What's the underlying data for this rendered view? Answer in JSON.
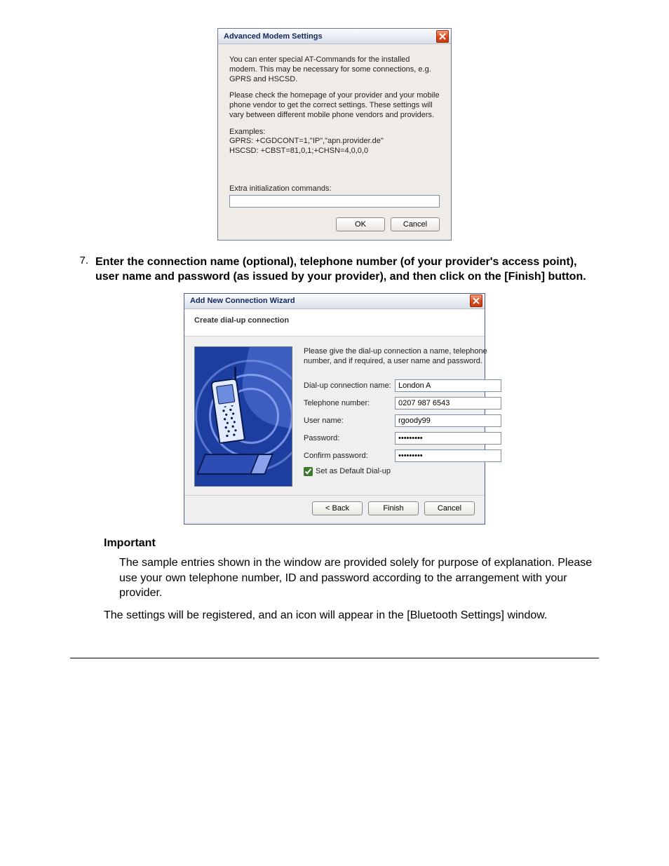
{
  "dlg1": {
    "title": "Advanced Modem Settings",
    "p1": "You can enter special AT-Commands for the installed modem. This may be necessary for some connections, e.g. GPRS and HSCSD.",
    "p2": "Please check the homepage of your provider and your mobile phone vendor to get the correct settings. These settings will vary between different mobile phone vendors and providers.",
    "examples_label": "Examples:",
    "example_gprs": "GPRS: +CGDCONT=1,\"IP\",\"apn.provider.de\"",
    "example_hscsd": "HSCSD: +CBST=81,0,1;+CHSN=4,0,0,0",
    "extra_label": "Extra initialization commands:",
    "extra_value": "",
    "ok": "OK",
    "cancel": "Cancel"
  },
  "step7": {
    "num": "7.",
    "text": "Enter the connection name (optional), telephone number (of your provider's access point), user name and password (as issued by your provider), and then click on the [Finish] button."
  },
  "dlg2": {
    "title": "Add New Connection Wizard",
    "subtitle": "Create dial-up connection",
    "intro": "Please give the dial-up connection a name, telephone number, and if required, a user name and password.",
    "conn_name_label": "Dial-up connection name:",
    "conn_name_value": "London A",
    "phone_label": "Telephone number:",
    "phone_value": "0207 987 6543",
    "user_label": "User name:",
    "user_value": "rgoody99",
    "pass_label": "Password:",
    "pass_value": "•••••••••",
    "confirm_label": "Confirm password:",
    "confirm_value": "•••••••••",
    "default_chk_label": "Set as Default Dial-up",
    "default_chk_checked": true,
    "back": "< Back",
    "finish": "Finish",
    "cancel": "Cancel"
  },
  "important": {
    "heading": "Important",
    "p1": "The sample entries shown in the window are provided solely for purpose of explanation. Please use your own telephone number, ID and password according to the arrangement with your provider.",
    "p2": "The settings will be registered, and an icon will appear in the [Bluetooth Settings] window."
  }
}
